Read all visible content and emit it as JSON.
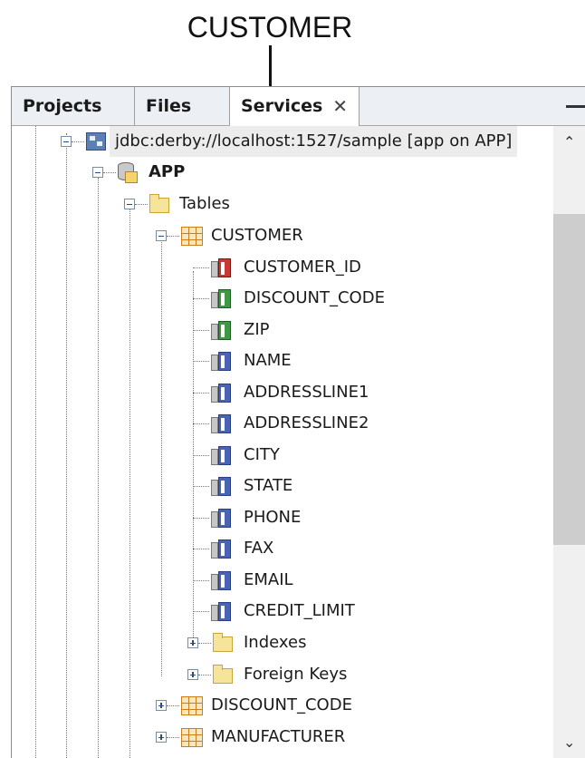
{
  "callout": {
    "label": "CUSTOMER"
  },
  "tabs": [
    {
      "label": "Projects",
      "active": false
    },
    {
      "label": "Files",
      "active": false
    },
    {
      "label": "Services",
      "active": true,
      "close": "✕"
    }
  ],
  "tree": {
    "connection": "jdbc:derby://localhost:1527/sample [app on APP]",
    "schema": "APP",
    "tables_folder": "Tables",
    "customer_table": "CUSTOMER",
    "columns": [
      {
        "name": "CUSTOMER_ID",
        "icon": "primary-key-column-icon",
        "color": "#c83a33"
      },
      {
        "name": "DISCOUNT_CODE",
        "icon": "foreign-key-column-icon",
        "color": "#3d9a42"
      },
      {
        "name": "ZIP",
        "icon": "foreign-key-column-icon",
        "color": "#3d9a42"
      },
      {
        "name": "NAME",
        "icon": "column-icon",
        "color": "#4a64b5"
      },
      {
        "name": "ADDRESSLINE1",
        "icon": "column-icon",
        "color": "#4a64b5"
      },
      {
        "name": "ADDRESSLINE2",
        "icon": "column-icon",
        "color": "#4a64b5"
      },
      {
        "name": "CITY",
        "icon": "column-icon",
        "color": "#4a64b5"
      },
      {
        "name": "STATE",
        "icon": "column-icon",
        "color": "#4a64b5"
      },
      {
        "name": "PHONE",
        "icon": "column-icon",
        "color": "#4a64b5"
      },
      {
        "name": "FAX",
        "icon": "column-icon",
        "color": "#4a64b5"
      },
      {
        "name": "EMAIL",
        "icon": "column-icon",
        "color": "#4a64b5"
      },
      {
        "name": "CREDIT_LIMIT",
        "icon": "column-icon",
        "color": "#4a64b5"
      }
    ],
    "indexes_folder": "Indexes",
    "foreign_keys_folder": "Foreign Keys",
    "other_tables": [
      "DISCOUNT_CODE",
      "MANUFACTURER"
    ]
  }
}
